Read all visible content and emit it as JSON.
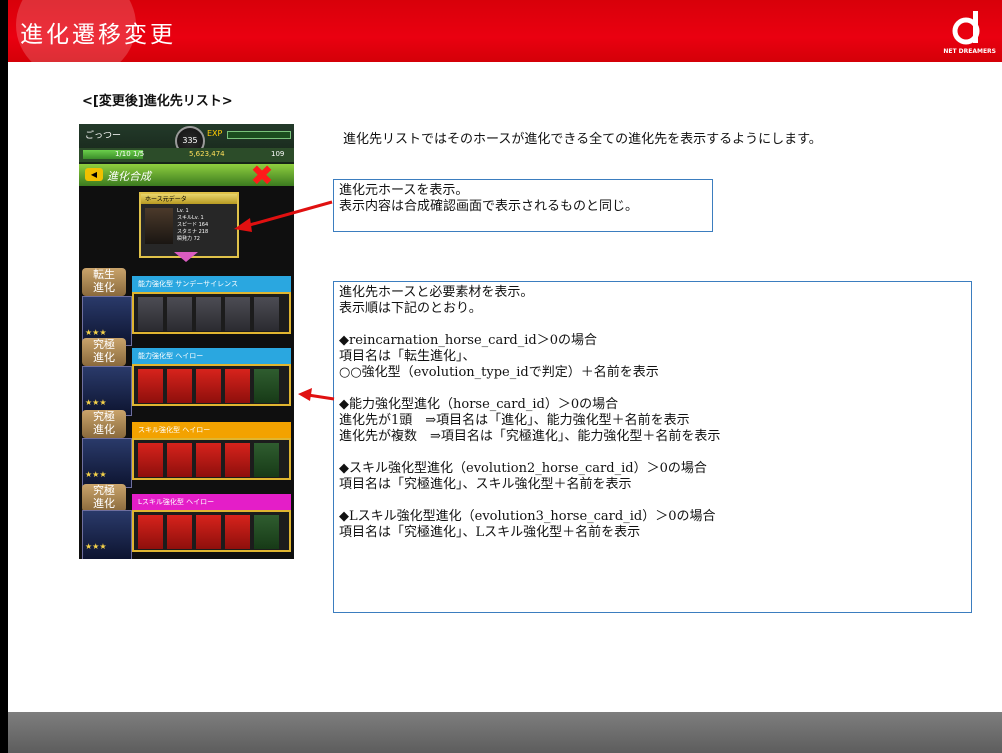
{
  "header": {
    "title": "進化遷移変更",
    "logo_text": "NET DREAMERS",
    "colors": {
      "bar": "#e5000d",
      "footer": "#6e6e6e"
    }
  },
  "section_title": "<[変更後]進化先リスト>",
  "phone": {
    "username": "ごっつー",
    "level": "335",
    "exp_label": "EXP",
    "stat_a": "1/10 1/5",
    "stat_b": "5,623,474",
    "stat_c": "109",
    "back_icon": "back-arrow-icon",
    "screen_title": "進化合成",
    "close_icon": "close-x-icon",
    "source_card": {
      "header": "ホース元データ",
      "lines": [
        "Lv.  1",
        "スキルLv.  1",
        "スピード  164",
        "スタミナ  218",
        "瞬発力  72"
      ]
    },
    "groups": [
      {
        "label_line1": "転生",
        "label_line2": "進化",
        "header": "能力強化型 サンデーサイレンス",
        "header_color": "#2aa7e0",
        "thumb_caption": "サンデーサイレンス",
        "materials": [
          "horse",
          "horse",
          "horse",
          "horse",
          "horse"
        ]
      },
      {
        "label_line1": "究極",
        "label_line2": "進化",
        "header": "能力強化型 ヘイロー",
        "header_color": "#2aa7e0",
        "thumb_caption": "ヘイロー",
        "materials": [
          "red",
          "red",
          "red",
          "red",
          "green"
        ]
      },
      {
        "label_line1": "究極",
        "label_line2": "進化",
        "header": "スキル強化型 ヘイロー",
        "header_color": "#f3a200",
        "thumb_caption": "ヘイロー",
        "materials": [
          "red",
          "red",
          "red",
          "red",
          "green"
        ]
      },
      {
        "label_line1": "究極",
        "label_line2": "進化",
        "header": "Lスキル強化型 ヘイロー",
        "header_color": "#e41ec8",
        "thumb_caption": "ヘイロー",
        "materials": [
          "red",
          "red",
          "red",
          "red",
          "green"
        ]
      }
    ]
  },
  "intro_text": "進化先リストではそのホースが進化できる全ての進化先を表示するようにします。",
  "box1": {
    "line1": "進化元ホースを表示。",
    "line2": "表示内容は合成確認画面で表示されるものと同じ。"
  },
  "box2": {
    "lines": [
      "進化先ホースと必要素材を表示。",
      "表示順は下記のとおり。",
      "",
      "◆reincarnation_horse_card_id＞0の場合",
      "項目名は「転生進化」、",
      "○○強化型（evolution_type_idで判定）＋名前を表示",
      "",
      "◆能力強化型進化（horse_card_id）＞0の場合",
      "進化先が1頭　⇒項目名は「進化」、能力強化型＋名前を表示",
      "進化先が複数　⇒項目名は「究極進化」、能力強化型＋名前を表示",
      "",
      "◆スキル強化型進化（evolution2_horse_card_id）＞0の場合",
      "項目名は「究極進化」、スキル強化型＋名前を表示",
      "",
      "◆Lスキル強化型進化（evolution3_horse_card_id）＞0の場合",
      "項目名は「究極進化」、Lスキル強化型＋名前を表示"
    ]
  }
}
